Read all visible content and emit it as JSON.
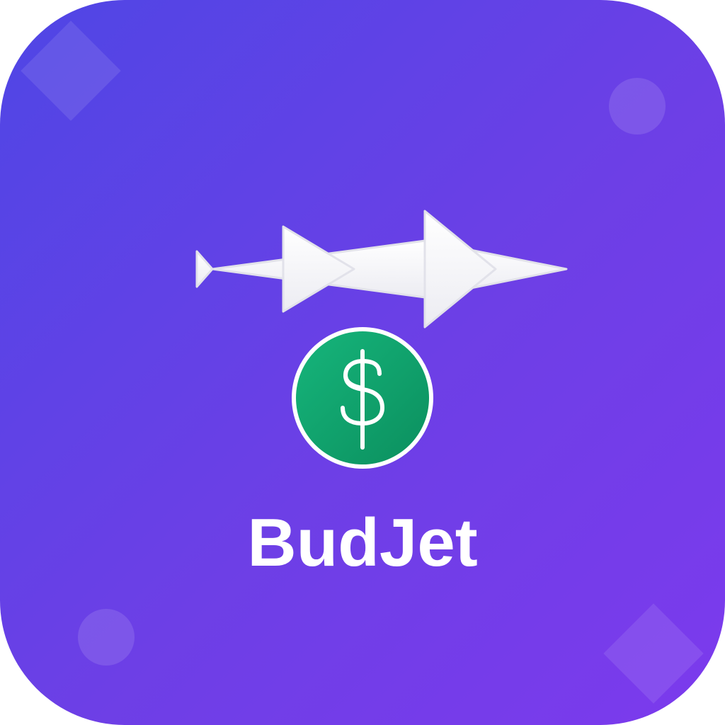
{
  "app": {
    "name": "BudJet"
  },
  "icons": {
    "jet": "jet-arrows-icon",
    "coin": "dollar-coin-icon"
  },
  "colors": {
    "background_start": "#4f46e5",
    "background_end": "#7c3aed",
    "jet_fill": "#f8f8fa",
    "coin_fill": "#10a06a",
    "coin_border": "#ffffff",
    "text": "#ffffff"
  }
}
